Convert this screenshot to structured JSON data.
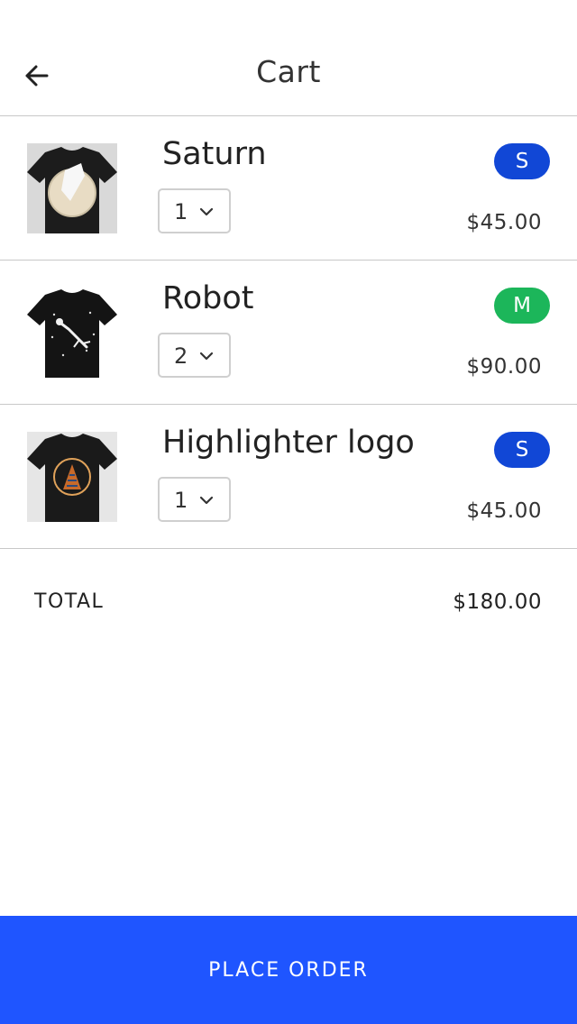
{
  "header": {
    "title": "Cart",
    "back_icon": "arrow-left-icon"
  },
  "colors": {
    "badge_s": "#1147d6",
    "badge_m": "#1cb65a",
    "place_order": "#1f55ff",
    "divider": "#c8c8c8"
  },
  "items": [
    {
      "name": "Saturn",
      "quantity": "1",
      "size": "S",
      "price": "$45.00",
      "image": "saturn-tshirt-image"
    },
    {
      "name": "Robot",
      "quantity": "2",
      "size": "M",
      "price": "$90.00",
      "image": "robot-tshirt-image"
    },
    {
      "name": "Highlighter logo",
      "quantity": "1",
      "size": "S",
      "price": "$45.00",
      "image": "highlighter-logo-tshirt-image"
    }
  ],
  "total": {
    "label": "TOTAL",
    "value": "$180.00"
  },
  "place_order": {
    "label": "PLACE ORDER"
  }
}
